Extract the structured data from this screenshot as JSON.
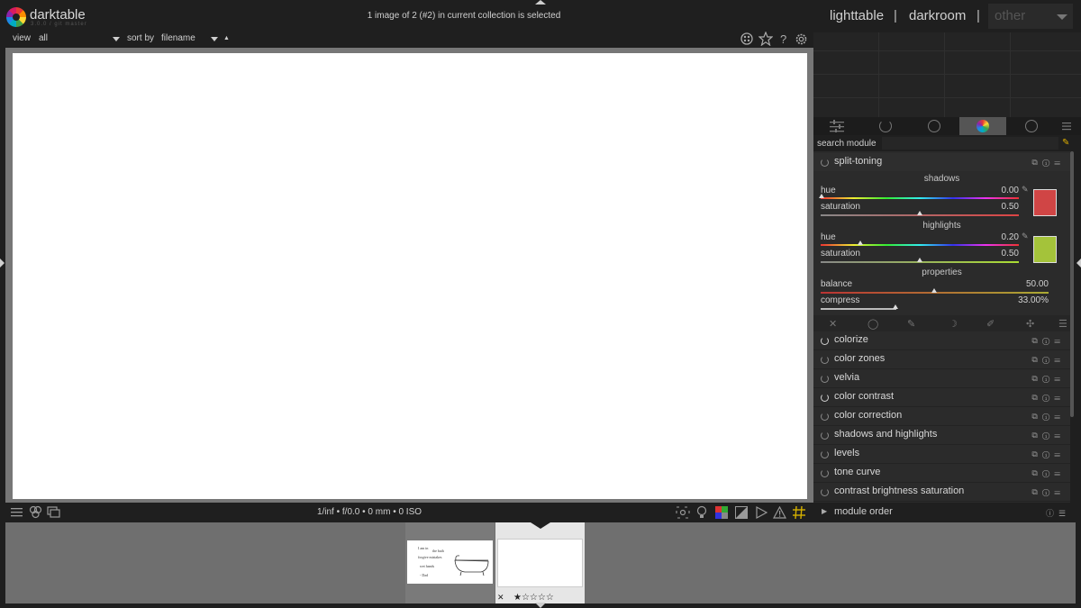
{
  "header": {
    "app_name": "darktable",
    "app_subtitle": "3.0.0 / git master",
    "selection_status": "1 image of 2 (#2) in current collection is selected",
    "views": [
      "lighttable",
      "darkroom",
      "other"
    ],
    "separator": "|"
  },
  "filterbar": {
    "view_label": "view",
    "view_value": "all",
    "sort_label": "sort by",
    "sort_value": "filename",
    "sort_direction": "▲"
  },
  "top_icons": [
    "grid-icon",
    "star-icon",
    "help-icon",
    "gear-icon"
  ],
  "bottom_toolbar": {
    "exif_info": "1/inf • f/0.0 • 0 mm • 0 ISO"
  },
  "filmstrip": {
    "thumb1_lines": [
      "I am in",
      "the bath",
      "forgive mistakes",
      "wet hands",
      "- Dad"
    ],
    "thumb2_reject": "✕",
    "thumb2_stars": "★☆☆☆☆"
  },
  "right_panel": {
    "search_label": "search module",
    "search_value": "",
    "active_module": {
      "name": "split-toning",
      "shadows_label": "shadows",
      "shadows_hue_label": "hue",
      "shadows_hue_value": "0.00",
      "shadows_sat_label": "saturation",
      "shadows_sat_value": "0.50",
      "shadows_color": "#d04545",
      "highlights_label": "highlights",
      "highlights_hue_label": "hue",
      "highlights_hue_value": "0.20",
      "highlights_sat_label": "saturation",
      "highlights_sat_value": "0.50",
      "highlights_color": "#a4c33a",
      "properties_label": "properties",
      "balance_label": "balance",
      "balance_value": "50.00",
      "compress_label": "compress",
      "compress_value": "33.00%"
    },
    "modules": [
      {
        "name": "colorize",
        "on": true
      },
      {
        "name": "color zones",
        "on": false
      },
      {
        "name": "velvia",
        "on": false
      },
      {
        "name": "color contrast",
        "on": true
      },
      {
        "name": "color correction",
        "on": false
      },
      {
        "name": "shadows and highlights",
        "on": false
      },
      {
        "name": "levels",
        "on": false
      },
      {
        "name": "tone curve",
        "on": false
      },
      {
        "name": "contrast brightness saturation",
        "on": false
      }
    ],
    "module_order_label": "module order"
  },
  "colors": {
    "accent_active_tab": "#555555",
    "panel_bg": "#2b2b2b",
    "center_bg": "#777777"
  }
}
